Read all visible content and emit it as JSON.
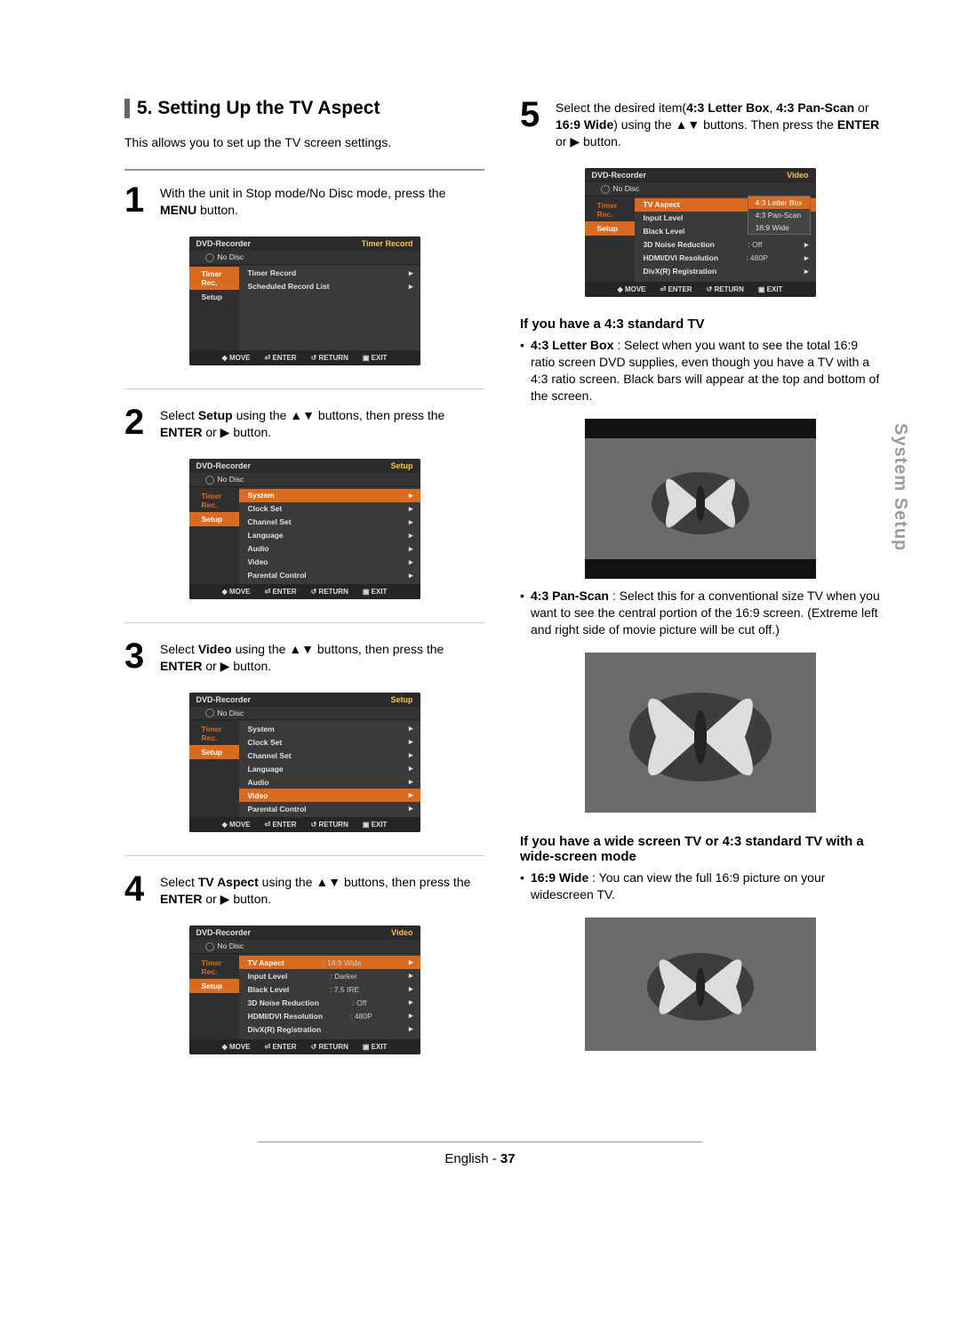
{
  "section": {
    "number": "5.",
    "title": "Setting Up the TV Aspect"
  },
  "intro": "This allows you to set up the TV screen settings.",
  "side_tab": "System Setup",
  "footer": {
    "lang": "English -",
    "page": "37"
  },
  "steps": {
    "s1": {
      "num": "1",
      "text_a": "With the unit in Stop mode/No Disc mode, press the ",
      "text_b": "MENU",
      "text_c": " button."
    },
    "s2": {
      "num": "2",
      "a": "Select ",
      "b": "Setup",
      "c": " using the ▲▼ buttons, then press the ",
      "d": "ENTER",
      "e": " or ▶ button."
    },
    "s3": {
      "num": "3",
      "a": "Select ",
      "b": "Video",
      "c": " using the ▲▼ buttons, then press the ",
      "d": "ENTER",
      "e": " or ▶ button."
    },
    "s4": {
      "num": "4",
      "a": "Select ",
      "b": "TV Aspect",
      "c": " using the ▲▼ buttons, then press the ",
      "d": "ENTER",
      "e": " or ▶ button."
    },
    "s5": {
      "num": "5",
      "a": "Select the desired item(",
      "b": "4:3 Letter Box",
      "c": ", ",
      "d": "4:3 Pan-Scan",
      "e": " or ",
      "f": "16:9 Wide",
      "g": ") using the ▲▼ buttons. Then press the ",
      "h": "ENTER",
      "i": " or ▶ button."
    }
  },
  "osd_common": {
    "title": "DVD-Recorder",
    "nodisc": "No Disc",
    "side_timer": "Timer Rec.",
    "side_setup": "Setup",
    "foot_move": "MOVE",
    "foot_enter": "ENTER",
    "foot_return": "RETURN",
    "foot_exit": "EXIT"
  },
  "osd1": {
    "tag": "Timer Record",
    "rows": [
      "Timer Record",
      "Scheduled Record List"
    ]
  },
  "osd2": {
    "tag": "Setup",
    "rows": [
      "System",
      "Clock Set",
      "Channel Set",
      "Language",
      "Audio",
      "Video",
      "Parental Control"
    ]
  },
  "osd3": {
    "tag": "Setup",
    "rows": [
      "System",
      "Clock Set",
      "Channel Set",
      "Language",
      "Audio",
      "Video",
      "Parental Control"
    ],
    "highlight": "Video"
  },
  "osd4": {
    "tag": "Video",
    "rows": [
      {
        "k": "TV Aspect",
        "v": ": 16:9 Wide"
      },
      {
        "k": "Input Level",
        "v": ": Darker"
      },
      {
        "k": "Black Level",
        "v": ": 7.5 IRE"
      },
      {
        "k": "3D Noise Reduction",
        "v": ": Off"
      },
      {
        "k": "HDMI/DVI Resolution",
        "v": ": 480P"
      },
      {
        "k": "DivX(R) Registration",
        "v": ""
      }
    ],
    "highlight": "TV Aspect"
  },
  "osd5": {
    "tag": "Video",
    "rows": [
      {
        "k": "TV Aspect",
        "v": ""
      },
      {
        "k": "Input Level",
        "v": ""
      },
      {
        "k": "Black Level",
        "v": ""
      },
      {
        "k": "3D Noise Reduction",
        "v": ": Off"
      },
      {
        "k": "HDMI/DVI Resolution",
        "v": ": 480P"
      },
      {
        "k": "DivX(R) Registration",
        "v": ""
      }
    ],
    "submenu": [
      "4:3 Letter Box",
      "4:3 Pan-Scan",
      "16:9 Wide"
    ],
    "highlight": "TV Aspect"
  },
  "right": {
    "h1": "If you have a 4:3 standard TV",
    "b1_label": "4:3 Letter Box",
    "b1_text": " : Select when you want to see the total 16:9 ratio screen DVD supplies, even though you have a TV with a 4:3 ratio screen. Black bars will appear at the top and bottom of the screen.",
    "b2_label": "4:3 Pan-Scan",
    "b2_text": " : Select this for a conventional size TV when you want to see the central portion of the 16:9 screen. (Extreme left and right side of movie picture will be cut off.)",
    "h2": "If you have a wide screen TV or 4:3 standard TV with a wide-screen mode",
    "b3_label": "16:9 Wide",
    "b3_text": " : You can view the full 16:9 picture on your widescreen TV."
  }
}
